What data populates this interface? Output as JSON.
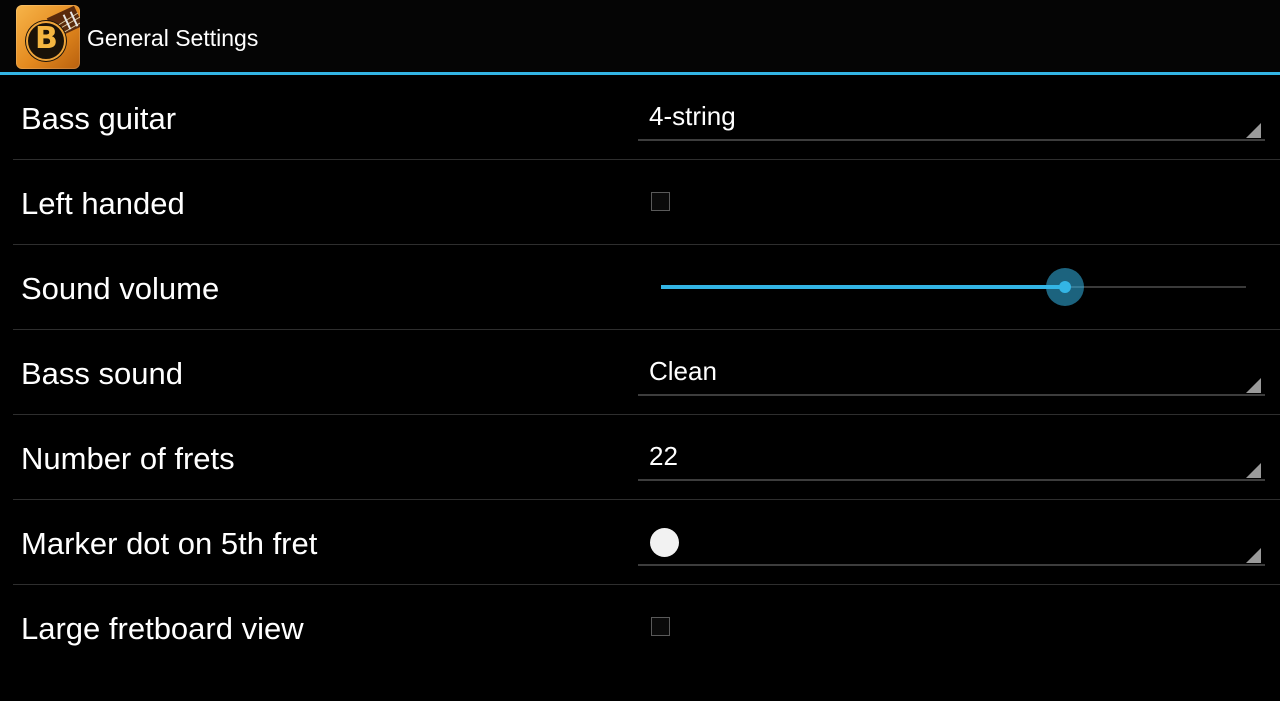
{
  "actionbar": {
    "title": "General Settings",
    "icon": "bass-guitar-app-icon",
    "icon_letter": "B"
  },
  "colors": {
    "accent": "#33b5e5",
    "background": "#000000",
    "text": "#ffffff"
  },
  "settings": {
    "bass_guitar": {
      "label": "Bass guitar",
      "value": "4-string"
    },
    "left_handed": {
      "label": "Left handed",
      "checked": false
    },
    "sound_volume": {
      "label": "Sound volume",
      "level": 0.69
    },
    "bass_sound": {
      "label": "Bass sound",
      "value": "Clean"
    },
    "number_of_frets": {
      "label": "Number of frets",
      "value": "22"
    },
    "marker_dot": {
      "label": "Marker dot on 5th fret",
      "value_icon": "white-dot"
    },
    "large_fretboard": {
      "label": "Large fretboard view",
      "checked": false
    }
  }
}
